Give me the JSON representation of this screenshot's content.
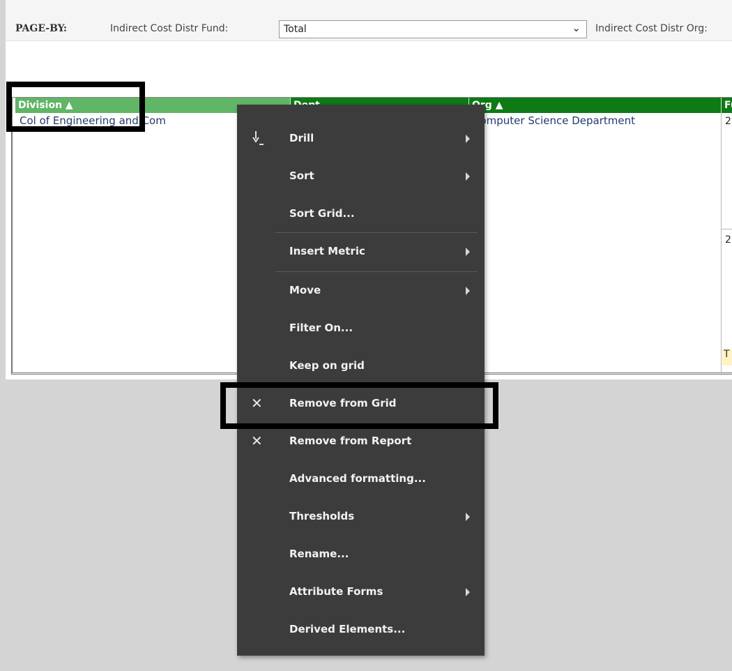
{
  "page_by": {
    "label": "PAGE-BY:",
    "fund_label": "Indirect Cost Distr Fund:",
    "fund_value": "Total",
    "org_label": "Indirect Cost Distr Org:"
  },
  "grid": {
    "headers": [
      "Division ▲",
      "Dept",
      "Org ▲",
      "Fu"
    ],
    "division_cell": "Col of Engineering and Com",
    "org_cell": "Computer Science Department",
    "fund_cell_1": "2",
    "fund_cell_2": "2",
    "total_cell": "T"
  },
  "menu": {
    "items": [
      {
        "label": "Drill",
        "submenu": true,
        "icon": "drill-icon"
      },
      {
        "label": "Sort",
        "submenu": true
      },
      {
        "label": "Sort Grid...",
        "submenu": false
      },
      {
        "label": "Insert Metric",
        "submenu": true
      },
      {
        "label": "Move",
        "submenu": true
      },
      {
        "label": "Filter On...",
        "submenu": false
      },
      {
        "label": "Keep on grid",
        "submenu": false
      },
      {
        "label": "Remove from Grid",
        "submenu": false,
        "icon": "close-icon"
      },
      {
        "label": "Remove from Report",
        "submenu": false,
        "icon": "close-icon"
      },
      {
        "label": "Advanced formatting...",
        "submenu": false
      },
      {
        "label": "Thresholds",
        "submenu": true
      },
      {
        "label": "Rename...",
        "submenu": false
      },
      {
        "label": "Attribute Forms",
        "submenu": true
      },
      {
        "label": "Derived Elements...",
        "submenu": false
      }
    ]
  },
  "colors": {
    "header_selected": "#60b566",
    "header": "#0d7a16",
    "menu_bg": "#3c3c3c",
    "highlight": "#000000"
  }
}
